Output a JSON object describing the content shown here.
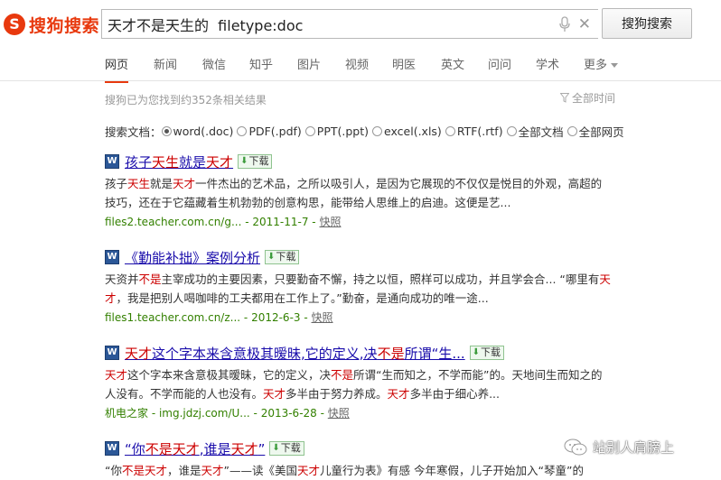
{
  "logo": {
    "mark": "S",
    "text": "搜狗搜索"
  },
  "search": {
    "query": "天才不是天生的  filetype:doc",
    "button": "搜狗搜索"
  },
  "nav": {
    "tabs": [
      {
        "label": "网页",
        "active": true
      },
      {
        "label": "新闻"
      },
      {
        "label": "微信"
      },
      {
        "label": "知乎"
      },
      {
        "label": "图片"
      },
      {
        "label": "视频"
      },
      {
        "label": "明医"
      },
      {
        "label": "英文"
      },
      {
        "label": "问问"
      },
      {
        "label": "学术"
      },
      {
        "label": "更多"
      }
    ]
  },
  "result_count": "搜狗已为您找到约352条相关结果",
  "time_filter": "全部时间",
  "doc_filter": {
    "label": "搜索文档：",
    "options": [
      "word(.doc)",
      "PDF(.pdf)",
      "PPT(.ppt)",
      "excel(.xls)",
      "RTF(.rtf)",
      "全部文档",
      "全部网页"
    ],
    "selected": "word(.doc)"
  },
  "download_label": "下载",
  "snapshot_label": "快照",
  "results": [
    {
      "title": [
        [
          "孩子",
          ""
        ],
        [
          "天生",
          "hl"
        ],
        [
          "就是",
          ""
        ],
        [
          "天才",
          "hl"
        ]
      ],
      "snippet": [
        [
          "孩子",
          ""
        ],
        [
          "天生",
          "hl"
        ],
        [
          "就是",
          ""
        ],
        [
          "天才",
          "hl"
        ],
        [
          "一件杰出的艺术品，之所以吸引人，是因为它展现的不仅仅是悦目的外观，高超的技巧，还在于它蕴藏着生机勃勃的创意构思，能带给人思维上的启迪。这便是艺...",
          ""
        ]
      ],
      "url": "files2.teacher.com.cn/g...",
      "date": "2011-11-7"
    },
    {
      "title": [
        [
          "《勤能补拙》案例分析",
          ""
        ]
      ],
      "snippet": [
        [
          "天资并",
          ""
        ],
        [
          "不是",
          "hl"
        ],
        [
          "主宰成功的主要因素，只要勤奋不懈，持之以恒，照样可以成功，并且学会合... “哪里有",
          ""
        ],
        [
          "天才",
          "hl"
        ],
        [
          "，我是把别人喝咖啡的工夫都用在工作上了。”勤奋，是通向成功的唯一途...",
          ""
        ]
      ],
      "url": "files1.teacher.com.cn/z...",
      "date": "2012-6-3"
    },
    {
      "title": [
        [
          "天才",
          "hl"
        ],
        [
          "这个字本来含意极其暧昧,它的定义,决",
          ""
        ],
        [
          "不是",
          "hl"
        ],
        [
          "所谓“生...",
          ""
        ]
      ],
      "snippet": [
        [
          "天才",
          "hl"
        ],
        [
          "这个字本来含意极其暧昧，它的定义，决",
          ""
        ],
        [
          "不是",
          "hl"
        ],
        [
          "所谓“生而知之，不学而能”的。天地间生而知之的人没有。不学而能的人也没有。",
          ""
        ],
        [
          "天才",
          "hl"
        ],
        [
          "多半由于努力养成。",
          ""
        ],
        [
          "天才",
          "hl"
        ],
        [
          "多半由于细心养...",
          ""
        ]
      ],
      "url": "机电之家 - img.jdzj.com/U...",
      "date": "2013-6-28"
    },
    {
      "title": [
        [
          "“你",
          ""
        ],
        [
          "不是天才",
          "hl"
        ],
        [
          ",谁是",
          ""
        ],
        [
          "天才",
          "hl"
        ],
        [
          "”",
          ""
        ]
      ],
      "snippet": [
        [
          "“你",
          ""
        ],
        [
          "不是天才",
          "hl"
        ],
        [
          "，谁是",
          ""
        ],
        [
          "天才",
          "hl"
        ],
        [
          "”——读《美国",
          ""
        ],
        [
          "天才",
          "hl"
        ],
        [
          "儿童行为表》有感 今年寒假，儿子开始加入“琴童”的",
          ""
        ]
      ],
      "url": "",
      "date": ""
    }
  ],
  "watermark": "站别人肩膀上",
  "colors": {
    "brand": "#e8390e",
    "link": "#1a0dab",
    "highlight": "#cc0000",
    "url": "#338000"
  }
}
